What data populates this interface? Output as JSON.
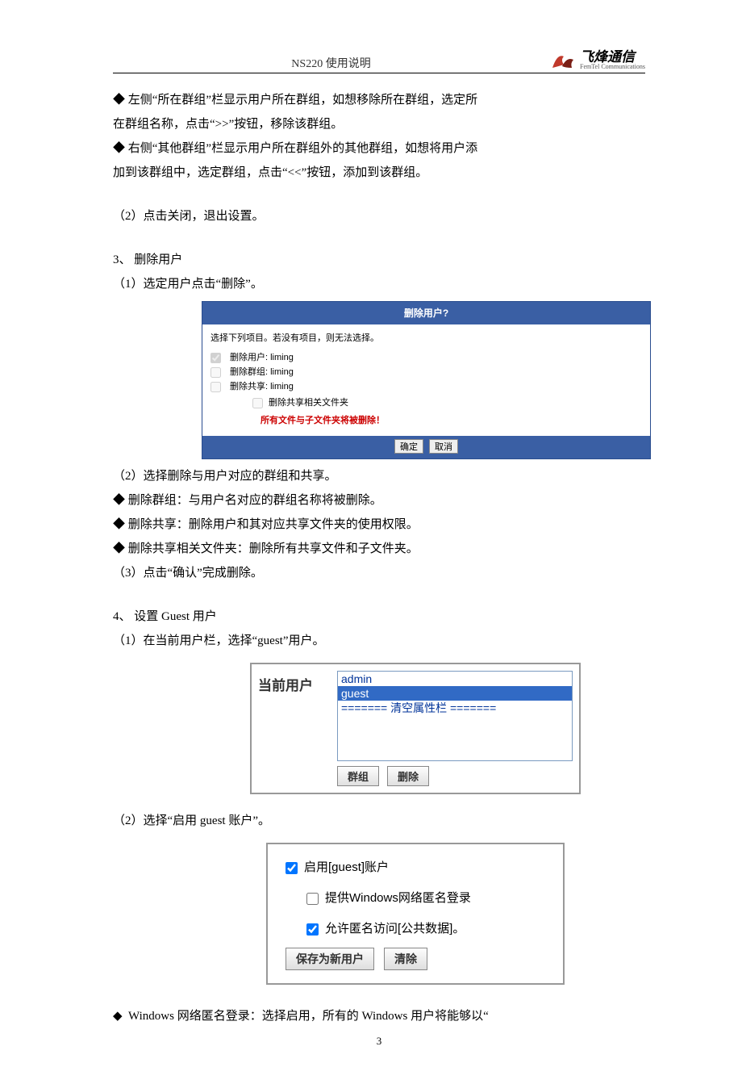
{
  "header": {
    "title": "NS220 使用说明",
    "logo_cn": "飞烽通信",
    "logo_en": "FemTel Communications"
  },
  "body": {
    "bullet_left": "左侧“所在群组”栏显示用户所在群组，如想移除所在群组，选定所",
    "bullet_left2": "在群组名称，点击“>>”按钮，移除该群组。",
    "bullet_right": "右侧“其他群组”栏显示用户所在群组外的其他群组，如想将用户添",
    "bullet_right2": "加到该群组中，选定群组，点击“<<”按钮，添加到该群组。",
    "step2_close": "（2）点击关闭，退出设置。",
    "section3": "3、 删除用户",
    "s3_step1": "（1）选定用户点击“删除”。",
    "s3_step2": "（2）选择删除与用户对应的群组和共享。",
    "s3_b1": "删除群组：与用户名对应的群组名称将被删除。",
    "s3_b2": "删除共享：删除用户和其对应共享文件夹的使用权限。",
    "s3_b3": "删除共享相关文件夹：删除所有共享文件和子文件夹。",
    "s3_step3": "（3）点击“确认”完成删除。",
    "section4": "4、 设置 Guest 用户",
    "s4_step1": "（1）在当前用户栏，选择“guest”用户。",
    "s4_step2": "（2）选择“启用 guest 账户”。",
    "s4_note": "Windows 网络匿名登录：选择启用，所有的 Windows 用户将能够以“"
  },
  "dialog1": {
    "title": "删除用户?",
    "instr": "选择下列项目。若没有项目，则无法选择。",
    "opt_user": "删除用户: liming",
    "opt_group": "删除群组: liming",
    "opt_share": "删除共享: liming",
    "opt_folders": "删除共享相关文件夹",
    "warn": "所有文件与子文件夹将被删除！",
    "btn_ok": "确定",
    "btn_cancel": "取消"
  },
  "dialog2": {
    "label": "当前用户",
    "item_admin": "admin",
    "item_guest": "guest",
    "item_clear": "======= 清空属性栏  =======",
    "btn_group": "群组",
    "btn_delete": "删除"
  },
  "dialog3": {
    "opt_enable": "启用[guest]账户",
    "opt_anon_win": "提供Windows网络匿名登录",
    "opt_anon_pub": "允许匿名访问[公共数据]。",
    "btn_save": "保存为新用户",
    "btn_clear": "清除"
  },
  "pagenum": "3"
}
